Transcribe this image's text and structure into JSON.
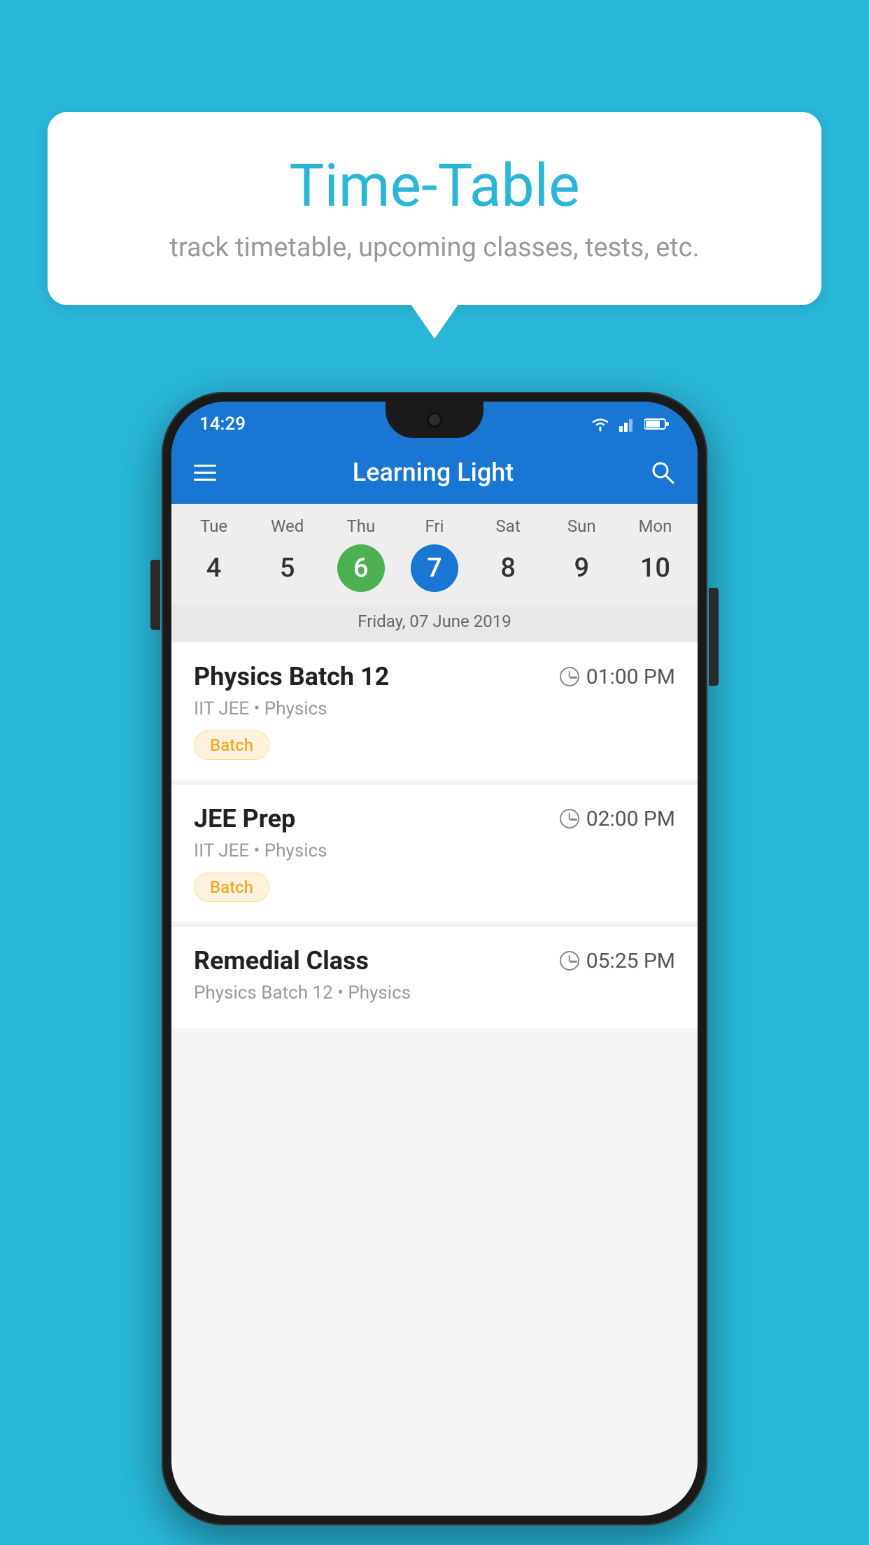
{
  "background_color": "#29B6D8",
  "speech_bubble": {
    "title": "Time-Table",
    "subtitle": "track timetable, upcoming classes, tests, etc."
  },
  "phone": {
    "status_bar": {
      "time": "14:29"
    },
    "app_bar": {
      "title": "Learning Light"
    },
    "calendar": {
      "days": [
        "Tue",
        "Wed",
        "Thu",
        "Fri",
        "Sat",
        "Sun",
        "Mon"
      ],
      "dates": [
        "4",
        "5",
        "6",
        "7",
        "8",
        "9",
        "10"
      ],
      "today_index": 2,
      "selected_index": 3,
      "selected_label": "Friday, 07 June 2019"
    },
    "schedule": [
      {
        "title": "Physics Batch 12",
        "time": "01:00 PM",
        "subtitle": "IIT JEE • Physics",
        "badge": "Batch"
      },
      {
        "title": "JEE Prep",
        "time": "02:00 PM",
        "subtitle": "IIT JEE • Physics",
        "badge": "Batch"
      },
      {
        "title": "Remedial Class",
        "time": "05:25 PM",
        "subtitle": "Physics Batch 12 • Physics",
        "badge": null
      }
    ]
  }
}
